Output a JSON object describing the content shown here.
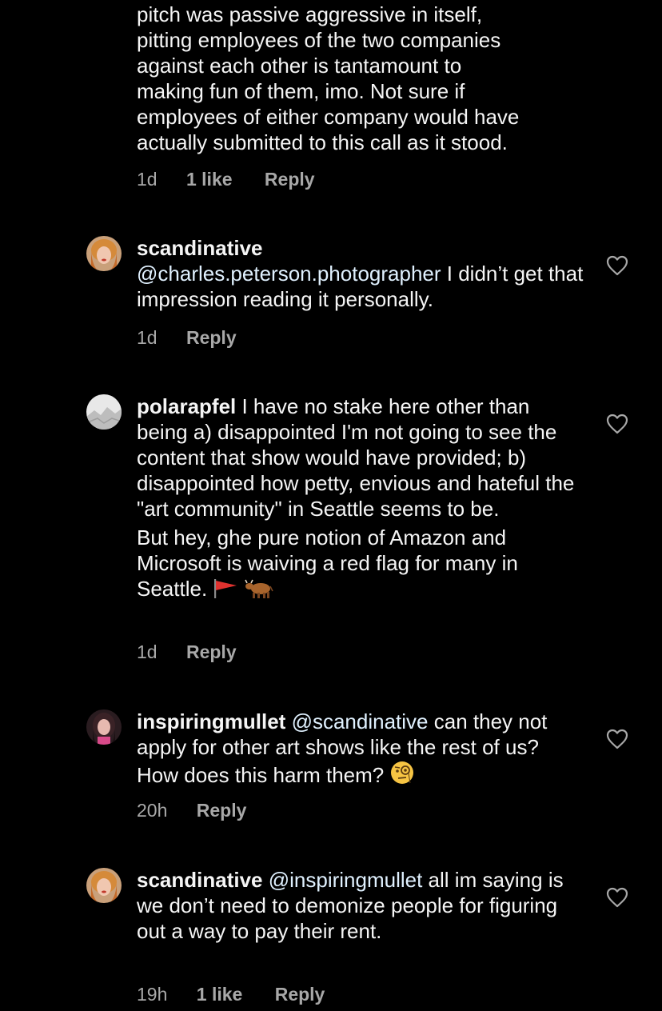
{
  "comments": [
    {
      "lines": [
        "pitch was passive aggressive in itself,",
        "pitting employees of the two companies",
        "against each other is tantamount to",
        "making fun of them, imo. Not sure if",
        "employees of either company would have",
        "actually submitted to this call as it stood."
      ],
      "time": "1d",
      "likes": "1 like",
      "reply": "Reply"
    },
    {
      "username": "scandinative",
      "mention": "@charles.peterson.photographer",
      "text_after_mention": " I didn’t get that impression reading it personally.",
      "time": "1d",
      "reply": "Reply"
    },
    {
      "username": "polarapfel",
      "text": " I have no stake here other than being a) disappointed I'm not going to see the content that show would have provided; b) disappointed how petty, envious and hateful the \"art community\" in Seattle seems to be.",
      "text2": "But hey, ghe pure notion of Amazon and Microsoft is waiving a red flag for many in Seattle. ",
      "emoji_names": [
        "red-flag-emoji",
        "ox-emoji"
      ],
      "time": "1d",
      "reply": "Reply"
    },
    {
      "username": "inspiringmullet",
      "mention": "@scandinative",
      "text_after_mention": " can they not apply for other art shows like the rest of us? How does this harm them? ",
      "emoji_names": [
        "face-with-monocle-emoji"
      ],
      "time": "20h",
      "reply": "Reply"
    },
    {
      "username": "scandinative",
      "mention": "@inspiringmullet",
      "text_after_mention": " all im saying is we don’t need to demonize people for figuring out a way to pay their rent.",
      "time": "19h",
      "likes": "1 like",
      "reply": "Reply"
    }
  ],
  "colors": {
    "background": "#000000",
    "text": "#f5f5f5",
    "mention": "#e0f1ff",
    "meta": "#a8a8a8"
  },
  "icons": [
    "heart-outline-icon"
  ]
}
